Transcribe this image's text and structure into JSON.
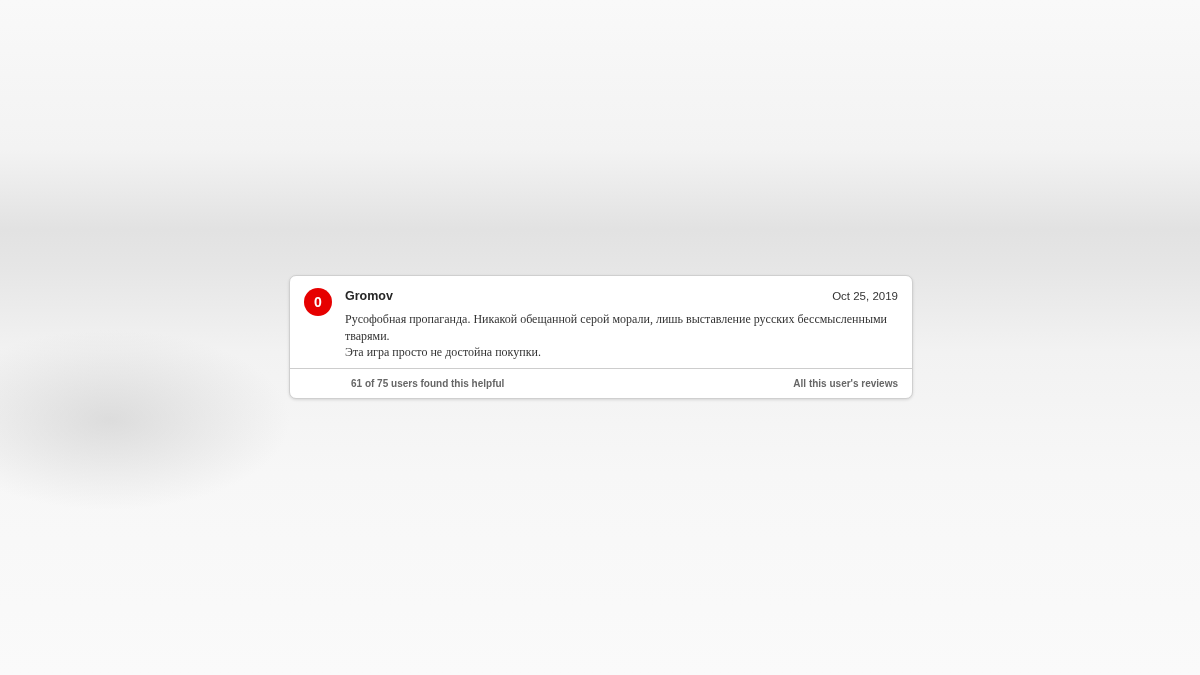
{
  "review": {
    "score": {
      "value": "0",
      "color": "#e60000"
    },
    "author": "Gromov",
    "date": "Oct 25, 2019",
    "paragraphs": [
      "Русофобная пропаганда. Никакой обещанной серой морали, лишь выставление русских бессмысленными тварями.",
      "Эта игра просто не достойна покупки."
    ],
    "helpful": "61 of 75 users found this helpful",
    "all_reviews_link": "All this user's reviews"
  }
}
